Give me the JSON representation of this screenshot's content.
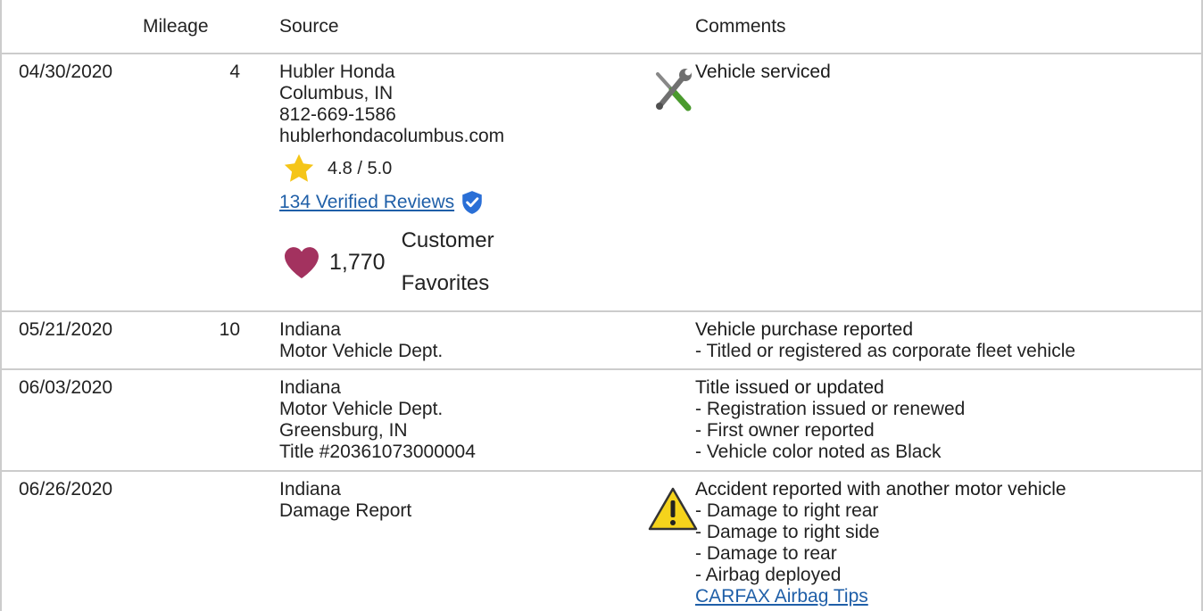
{
  "header": {
    "mileage": "Mileage",
    "source": "Source",
    "comments": "Comments"
  },
  "rows": [
    {
      "date": "04/30/2020",
      "mileage": "4",
      "source_lines": [
        "Hubler Honda",
        "Columbus, IN",
        "812-669-1586",
        "hublerhondacolumbus.com"
      ],
      "rating": "4.8 / 5.0",
      "reviews_link": "134 Verified Reviews",
      "favorites_count": "1,770",
      "favorites_label_1": "Customer",
      "favorites_label_2": "Favorites",
      "icon": "wrench-screwdriver-icon",
      "comment_title": "Vehicle serviced",
      "comment_lines": []
    },
    {
      "date": "05/21/2020",
      "mileage": "10",
      "source_lines": [
        "Indiana",
        "Motor Vehicle Dept."
      ],
      "comment_title": "Vehicle purchase reported",
      "comment_lines": [
        "- Titled or registered as corporate fleet vehicle"
      ]
    },
    {
      "date": "06/03/2020",
      "mileage": "",
      "source_lines": [
        "Indiana",
        "Motor Vehicle Dept.",
        "Greensburg, IN",
        "Title #20361073000004"
      ],
      "comment_title": "Title issued or updated",
      "comment_lines": [
        "- Registration issued or renewed",
        "- First owner reported",
        "- Vehicle color noted as Black"
      ]
    },
    {
      "date": "06/26/2020",
      "mileage": "",
      "source_lines": [
        "Indiana",
        "Damage Report"
      ],
      "icon": "warning-icon",
      "comment_title": "Accident reported with another motor vehicle",
      "comment_lines": [
        "- Damage to right rear",
        "- Damage to right side",
        "- Damage to rear",
        "- Airbag deployed"
      ],
      "comment_link": "CARFAX Airbag Tips"
    }
  ],
  "colors": {
    "border": "#cccccc",
    "link": "#1f5fa8",
    "star": "#f5c518",
    "heart": "#a3325f",
    "shield": "#2a6fd6",
    "warning": "#f5d31c"
  }
}
